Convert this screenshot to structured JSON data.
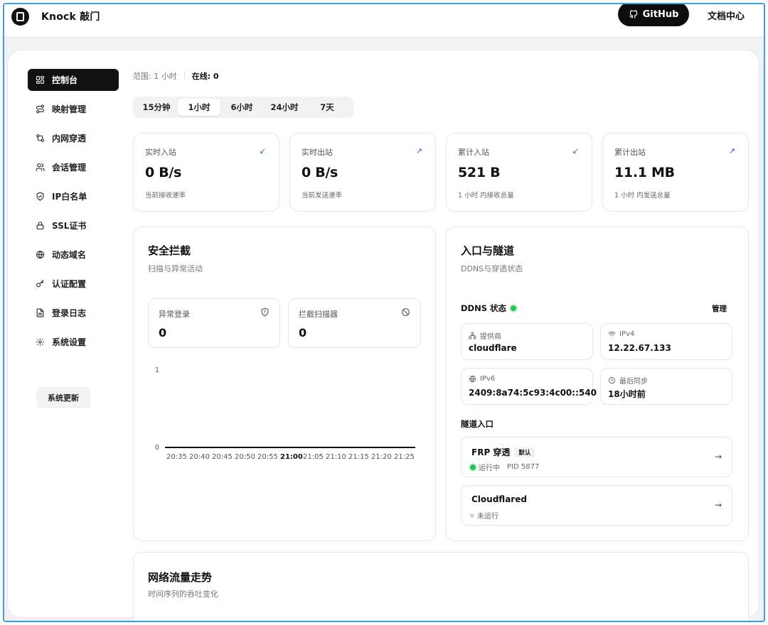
{
  "header": {
    "brand": "Knock 敲门",
    "github_label": "GitHub",
    "docs_label": "文档中心"
  },
  "sidebar": {
    "items": [
      {
        "label": "控制台",
        "icon": "grid-icon",
        "active": true
      },
      {
        "label": "映射管理",
        "icon": "route-icon"
      },
      {
        "label": "内网穿透",
        "icon": "tunnel-icon"
      },
      {
        "label": "会话管理",
        "icon": "users-icon"
      },
      {
        "label": "IP白名单",
        "icon": "shield-check-icon"
      },
      {
        "label": "SSL证书",
        "icon": "lock-icon"
      },
      {
        "label": "动态域名",
        "icon": "globe-icon"
      },
      {
        "label": "认证配置",
        "icon": "key-icon"
      },
      {
        "label": "登录日志",
        "icon": "file-text-icon"
      },
      {
        "label": "系统设置",
        "icon": "gear-icon"
      }
    ],
    "update_label": "系统更新"
  },
  "status": {
    "range_text": "范围: 1 小时",
    "online_text": "在线: 0"
  },
  "time_tabs": [
    {
      "label": "15分钟"
    },
    {
      "label": "1小时",
      "selected": true
    },
    {
      "label": "6小时"
    },
    {
      "label": "24小时"
    },
    {
      "label": "7天"
    }
  ],
  "stats": [
    {
      "label": "实时入站",
      "value": "0 B/s",
      "sub": "当前接收速率",
      "arrow": "↙",
      "arrow_color": "#1f8a66"
    },
    {
      "label": "实时出站",
      "value": "0 B/s",
      "sub": "当前发送速率",
      "arrow": "↗",
      "arrow_color": "#2d5fd4"
    },
    {
      "label": "累计入站",
      "value": "521 B",
      "sub": "1 小时 内接收总量",
      "arrow": "↙",
      "arrow_color": "#1f8a66"
    },
    {
      "label": "累计出站",
      "value": "11.1 MB",
      "sub": "1 小时 内发送总量",
      "arrow": "↗",
      "arrow_color": "#4a3ad0"
    }
  ],
  "security": {
    "title": "安全拦截",
    "subtitle": "扫描与异常活动",
    "abnormal_login": {
      "label": "异常登录",
      "value": "0"
    },
    "scanner_block": {
      "label": "拦截扫描器",
      "value": "0"
    }
  },
  "chart_data": {
    "type": "line",
    "x": [
      "20:35",
      "20:40",
      "20:45",
      "20:50",
      "20:55",
      "21:00",
      "21:05",
      "21:10",
      "21:15",
      "21:20",
      "21:25"
    ],
    "highlight_x": "21:00",
    "series": [
      {
        "values": [
          0,
          0,
          0,
          0,
          0,
          0,
          0,
          0,
          0,
          0,
          0
        ]
      }
    ],
    "ylim": [
      0,
      1
    ],
    "y_ticks": [
      "0",
      "1"
    ],
    "grid": false
  },
  "entry": {
    "title": "入口与隧道",
    "subtitle": "DDNS与穿透状态",
    "ddns_label": "DDNS 状态",
    "ddns_color": "#22c55e",
    "manage_label": "管理",
    "provider": {
      "label": "提供商",
      "value": "cloudflare"
    },
    "ipv4": {
      "label": "IPv4",
      "value": "12.22.67.133"
    },
    "ipv6": {
      "label": "IPv6",
      "value": "2409:8a74:5c93:4c00::540"
    },
    "last_sync": {
      "label": "最后同步",
      "value": "18小时前"
    },
    "tunnel_label": "隧道入口",
    "tunnels": [
      {
        "name": "FRP 穿透",
        "badge": "默认",
        "status": "运行中",
        "pid": "PID 5877",
        "status_color": "#22c55e"
      },
      {
        "name": "Cloudflared",
        "status": "未运行",
        "status_color": "#d4d4d8"
      }
    ]
  },
  "traffic": {
    "title": "网络流量走势",
    "subtitle": "时间序列的吞吐变化"
  }
}
